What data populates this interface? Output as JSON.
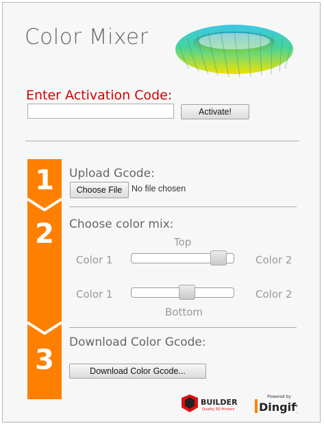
{
  "app": {
    "title": "Color Mixer"
  },
  "activation": {
    "label": "Enter Activation Code:",
    "value": "",
    "button": "Activate!"
  },
  "steps": [
    {
      "number": "1",
      "heading": "Upload Gcode:"
    },
    {
      "number": "2",
      "heading": "Choose color mix:"
    },
    {
      "number": "3",
      "heading": "Download Color Gcode:"
    }
  ],
  "upload": {
    "button": "Choose File",
    "status": "No file chosen"
  },
  "mix": {
    "top_label": "Top",
    "bottom_label": "Bottom",
    "left_label": "Color 1",
    "right_label": "Color 2",
    "top_slider_value": 0.92,
    "bottom_slider_value": 0.55
  },
  "download": {
    "button": "Download Color Gcode..."
  },
  "footer": {
    "builder_logo": "BUILDER",
    "builder_tagline": "Quality 3D Printers",
    "dingify_powered": "Powered by",
    "dingify_name": "Dingify"
  },
  "colors": {
    "accent": "#ff8000",
    "activation_label": "#d00000"
  }
}
